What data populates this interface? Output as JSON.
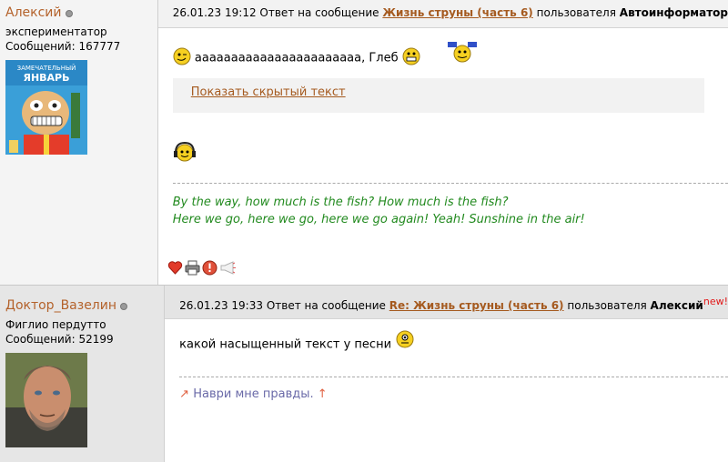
{
  "posts": [
    {
      "author": "Алексий",
      "title": "экспериментатор",
      "messages": "Сообщений: 167777",
      "date": "26.01.23 19:12",
      "reply_prefix": "Ответ на сообщение",
      "reply_link": "Жизнь струны (часть 6)",
      "user_prefix": "пользователя",
      "reply_user": "Автоинформатор",
      "text": "ааааааааааааааааааааааа, Глеб",
      "spoiler_label": "Показать скрытый текст",
      "signature_line1": "By the way, how much is the fish? How much is the fish?",
      "signature_line2": "Here we go, here we go, here we go again! Yeah! Sunshine in the air!",
      "avatar_caption": "ЗАМЕЧАТЕЛЬНЫЙ ЯНВАРЬ",
      "tool_icons": [
        "heart-icon",
        "printer-icon",
        "alert-icon",
        "megaphone-icon"
      ]
    },
    {
      "author": "Доктор_Вазелин",
      "title": "Фиглио пердутто",
      "messages": "Сообщений: 52199",
      "date": "26.01.23 19:33",
      "reply_prefix": "Ответ на сообщение",
      "reply_link": "Re: Жизнь струны (часть 6)",
      "user_prefix": "пользователя",
      "reply_user": "Алексий",
      "new_badge": "new!",
      "text": "какой насыщенный текст у песни",
      "signature": "Наври мне правды."
    }
  ],
  "colors": {
    "link": "#a55a1f",
    "signature": "#228a1f",
    "new": "#e21a1a"
  }
}
